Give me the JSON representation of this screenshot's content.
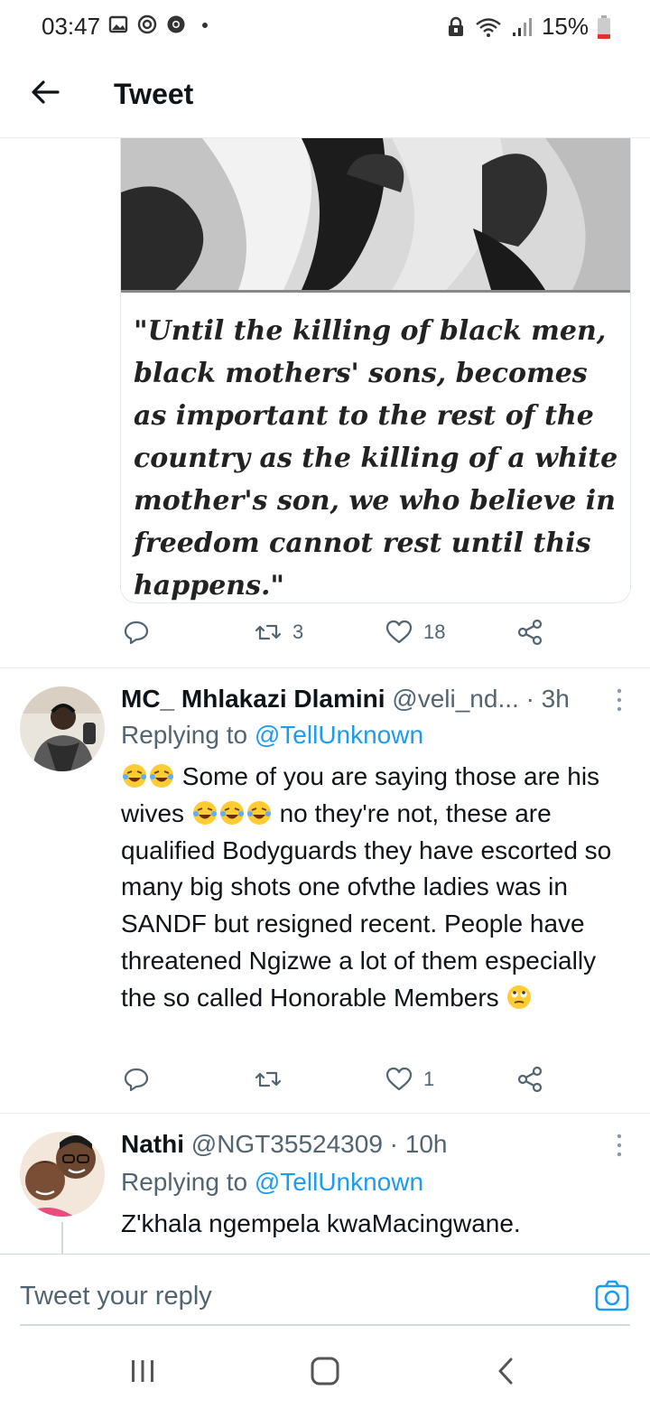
{
  "status": {
    "time": "03:47",
    "battery": "15%",
    "left_icons": [
      "gallery-icon",
      "cast-icon",
      "chrome-icon",
      "dot-icon"
    ],
    "right_icons": [
      "lock-icon",
      "wifi-icon",
      "signal-icon",
      "battery-icon"
    ]
  },
  "header": {
    "title": "Tweet",
    "back_icon": "arrow-left-icon"
  },
  "media": {
    "quote": "\"Until the killing of black men, black mothers' sons, becomes as important to the rest of the country as the killing of a white mother's son, we who believe in freedom cannot rest until this happens.\""
  },
  "main_tweet_actions": {
    "reply_count": "",
    "retweet_count": "3",
    "like_count": "18"
  },
  "replies": [
    {
      "name": "MC_ Mhlakazi Dlamini",
      "handle": "@veli_nd...",
      "time": "· 3h",
      "replying_prefix": "Replying to",
      "replying_to": "@TellUnknown",
      "text_part1": "Some of you are saying those are his wives",
      "text_part2": "no they're not, these are qualified Bodyguards they have escorted so many big shots one ofvthe ladies was in SANDF but resigned recent. People have threatened Ngizwe a lot of them especially the so called Honorable Members",
      "retweet_count": "",
      "like_count": "1"
    },
    {
      "name": "Nathi",
      "handle": "@NGT35524309",
      "time": "· 10h",
      "replying_prefix": "Replying to",
      "replying_to": "@TellUnknown",
      "text": "Z'khala ngempela kwaMacingwane."
    }
  ],
  "composer": {
    "placeholder": "Tweet your reply"
  },
  "colors": {
    "accent": "#1d9bf0",
    "text_primary": "#0f1419",
    "text_secondary": "#536471",
    "border": "#e6ecf0"
  }
}
